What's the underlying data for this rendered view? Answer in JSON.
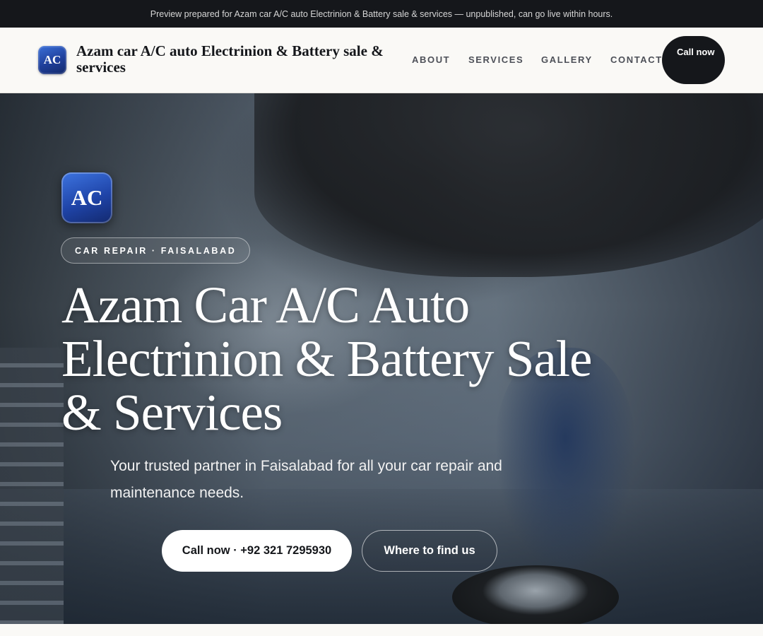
{
  "banner": {
    "text": "Preview prepared for Azam car A/C auto Electrinion & Battery sale & services — unpublished, can go live within hours."
  },
  "header": {
    "logo_text": "AC",
    "brand_name": "Azam car A/C auto Electrinion & Battery sale & services",
    "nav": [
      {
        "label": "ABOUT"
      },
      {
        "label": "SERVICES"
      },
      {
        "label": "GALLERY"
      },
      {
        "label": "CONTACT"
      }
    ],
    "cta_label": "Call now"
  },
  "hero": {
    "logo_text": "AC",
    "eyebrow": "CAR REPAIR · FAISALABAD",
    "title": "Azam Car A/C Auto Electrinion & Battery Sale & Services",
    "subtitle": "Your trusted partner in Faisalabad for all your car repair and maintenance needs.",
    "primary_button": "Call now · +92 321 7295930",
    "secondary_button": "Where to find us"
  },
  "colors": {
    "banner_bg": "#15171b",
    "nav_bg": "#faf9f6",
    "brand_blue": "#1f44a8",
    "cta_dark": "#15171b"
  }
}
